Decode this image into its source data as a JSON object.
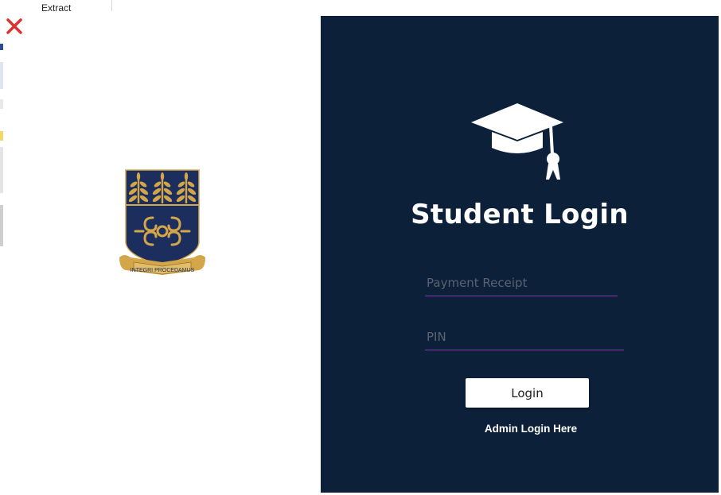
{
  "background_window": {
    "tab_label": "Extract"
  },
  "crest": {
    "motto": "INTEGRI PROCEDAMUS"
  },
  "login": {
    "title": "Student Login",
    "receipt_placeholder": "Payment Receipt",
    "receipt_value": "",
    "pin_placeholder": "PIN",
    "pin_value": "",
    "button_label": "Login",
    "admin_link": "Admin Login Here"
  },
  "icons": {
    "close": "close-icon",
    "cap": "graduation-cap-icon"
  },
  "colors": {
    "panel_bg": "#0c2139",
    "input_underline": "#8a3aa7",
    "crest_navy": "#1b2e5e",
    "crest_gold": "#d3a64a",
    "close_red": "#e03030"
  }
}
